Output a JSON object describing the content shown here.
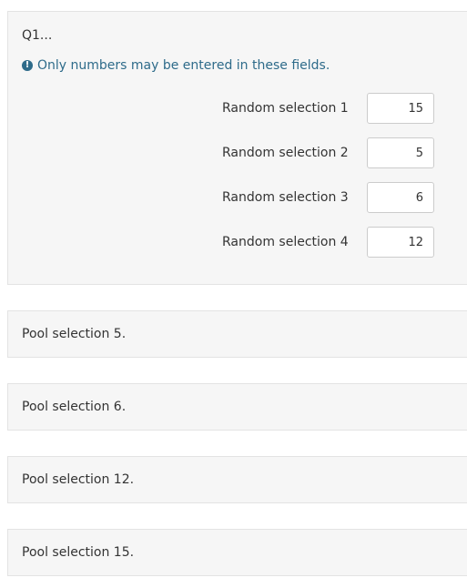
{
  "question": {
    "title": "Q1...",
    "notice_icon": "exclamation-circle-icon",
    "notice": "Only numbers may be entered in these fields.",
    "notice_color": "#2e6b8a",
    "fields": [
      {
        "label": "Random selection 1",
        "value": "15"
      },
      {
        "label": "Random selection 2",
        "value": "5"
      },
      {
        "label": "Random selection 3",
        "value": "6"
      },
      {
        "label": "Random selection 4",
        "value": "12"
      }
    ]
  },
  "pools": [
    {
      "text": "Pool selection 5."
    },
    {
      "text": "Pool selection 6."
    },
    {
      "text": "Pool selection 12."
    },
    {
      "text": "Pool selection 15."
    }
  ]
}
